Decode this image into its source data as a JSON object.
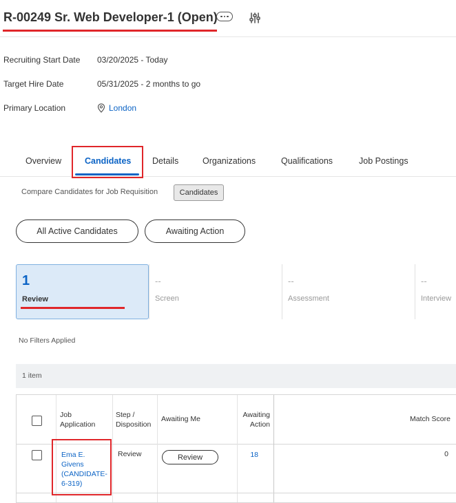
{
  "header": {
    "title": "R-00249 Sr. Web Developer-1 (Open)",
    "more_icon": "ellipsis-icon",
    "settings_icon": "sliders-icon"
  },
  "fields": [
    {
      "label": "Recruiting Start Date",
      "value": "03/20/2025 - Today"
    },
    {
      "label": "Target Hire Date",
      "value": "05/31/2025 - 2 months to go"
    },
    {
      "label": "Primary Location",
      "value": "London",
      "icon": "location-pin-icon"
    }
  ],
  "tabs": [
    {
      "label": "Overview"
    },
    {
      "label": "Candidates",
      "active": true
    },
    {
      "label": "Details"
    },
    {
      "label": "Organizations"
    },
    {
      "label": "Qualifications"
    },
    {
      "label": "Job Postings"
    }
  ],
  "subnav": {
    "compare_label": "Compare Candidates for Job Requisition",
    "chip_label": "Candidates"
  },
  "filters": {
    "all_active": "All Active Candidates",
    "awaiting": "Awaiting Action"
  },
  "stages": [
    {
      "count": "1",
      "label": "Review",
      "active": true
    },
    {
      "count": "--",
      "label": "Screen"
    },
    {
      "count": "--",
      "label": "Assessment"
    },
    {
      "count": "--",
      "label": "Interview"
    }
  ],
  "no_filters": "No Filters Applied",
  "items_count": "1 item",
  "grid": {
    "columns": {
      "job_application": [
        "Job",
        "Application"
      ],
      "step": [
        "Step /",
        "Disposition"
      ],
      "awaiting_me": "Awaiting Me",
      "awaiting_action": [
        "Awaiting",
        "Action"
      ],
      "match_score": "Match Score"
    },
    "rows": [
      {
        "candidate": [
          "Ema E.",
          "Givens",
          "(CANDIDATE-",
          "6-319)"
        ],
        "step": "Review",
        "awaiting_me_button": "Review",
        "awaiting_action": "18",
        "match_score": "0"
      }
    ]
  },
  "colors": {
    "accent": "#0b63c5",
    "highlight": "#e0262a",
    "active_stage_bg": "#dceaf8"
  }
}
